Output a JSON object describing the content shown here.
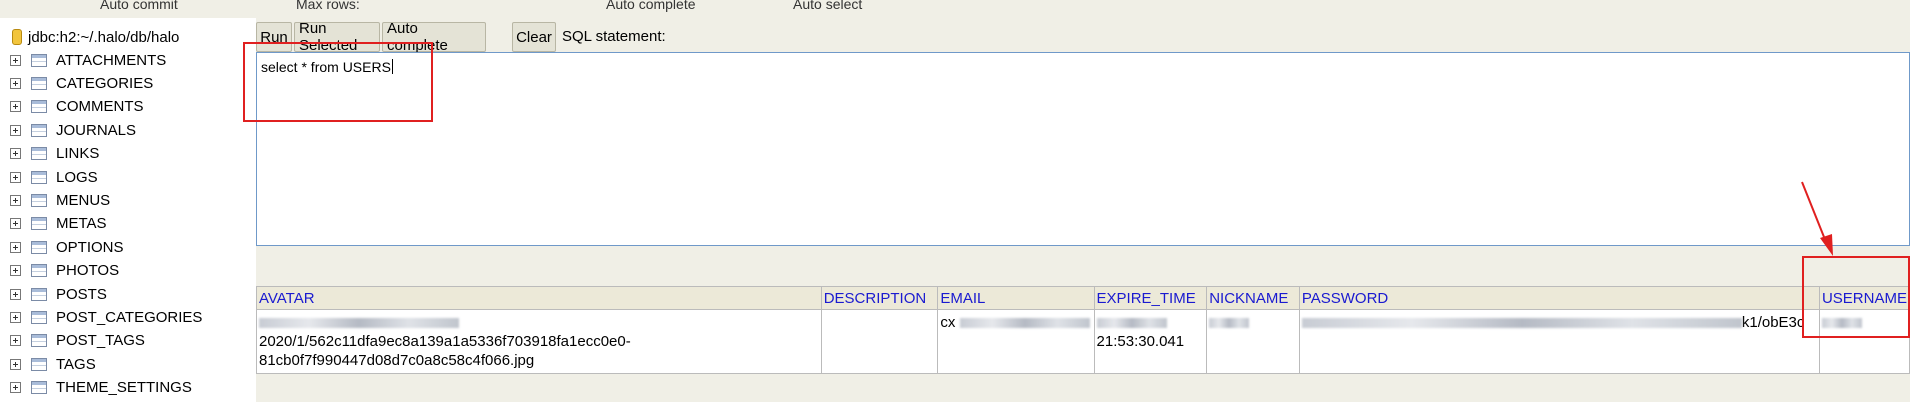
{
  "tree": {
    "db_label": "jdbc:h2:~/.halo/db/halo",
    "tables": [
      "ATTACHMENTS",
      "CATEGORIES",
      "COMMENTS",
      "JOURNALS",
      "LINKS",
      "LOGS",
      "MENUS",
      "METAS",
      "OPTIONS",
      "PHOTOS",
      "POSTS",
      "POST_CATEGORIES",
      "POST_TAGS",
      "TAGS",
      "THEME_SETTINGS"
    ]
  },
  "toolbar": {
    "run": "Run",
    "run_selected": "Run Selected",
    "auto_complete": "Auto complete",
    "clear": "Clear",
    "sql_label": "SQL statement:"
  },
  "topbar": {
    "auto_commit": "Auto commit",
    "max_rows": "Max rows:",
    "auto_complete": "Auto complete",
    "auto_select": "Auto select"
  },
  "editor": {
    "sql": "select * from USERS"
  },
  "results": {
    "columns": [
      "AVATAR",
      "DESCRIPTION",
      "EMAIL",
      "EXPIRE_TIME",
      "NICKNAME",
      "PASSWORD",
      "USERNAME"
    ],
    "row": {
      "avatar_line1": "2020/1/562c11dfa9ec8a139a1a5336f703918fa1ecc0e0-",
      "avatar_line2": "81cb0f7f990447d08d7c0a8c58c4f066.jpg",
      "email": "cx",
      "expire_time": "21:53:30.041",
      "password_tail": "k1/obE3c"
    }
  },
  "colors": {
    "annotation": "#e02020",
    "header_text": "#1a1ad0",
    "panel_bg": "#f0efe6"
  }
}
